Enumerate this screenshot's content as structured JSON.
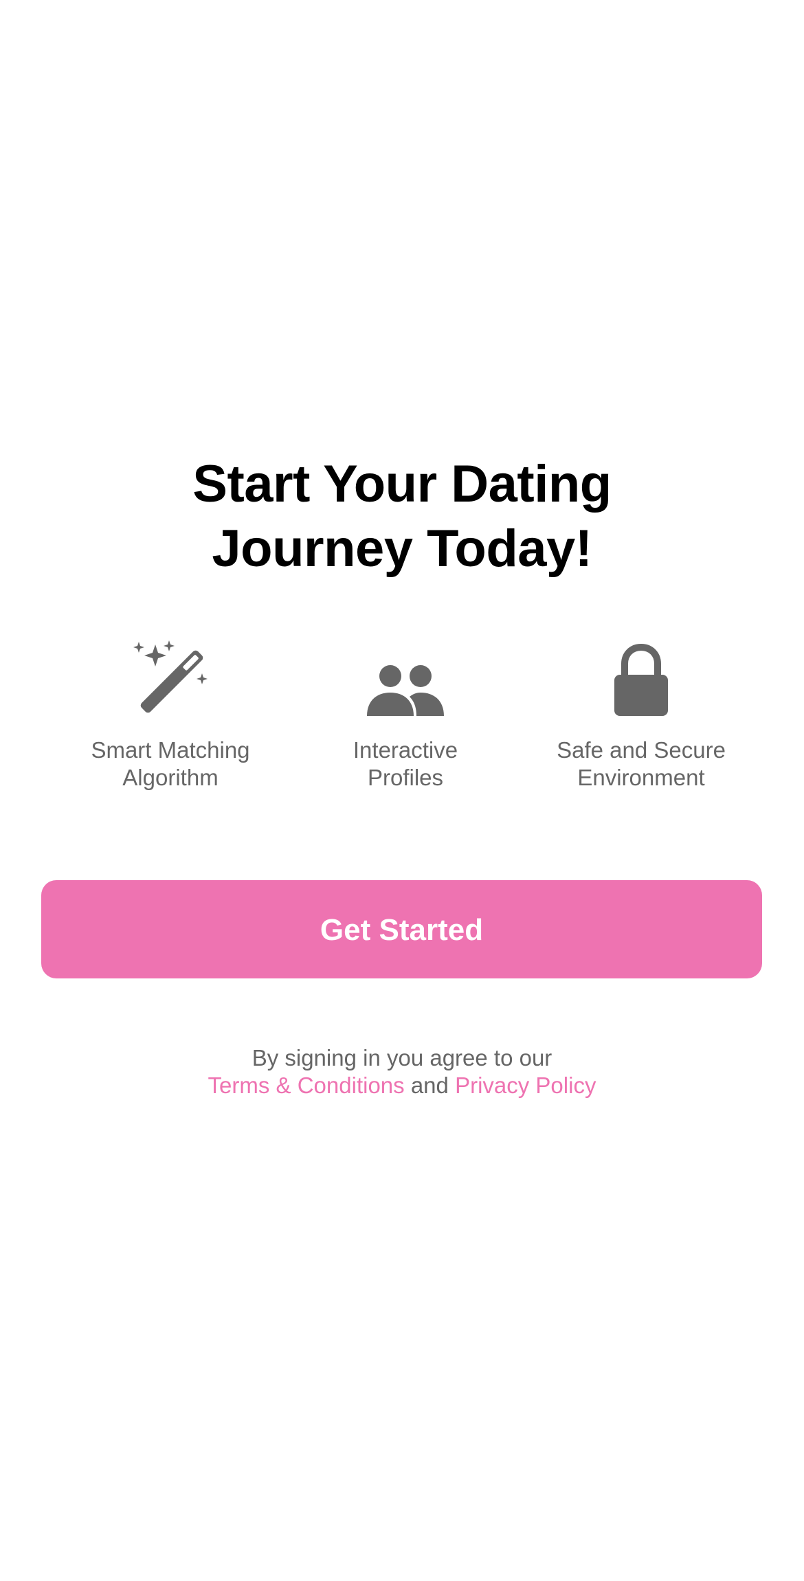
{
  "headline": {
    "line1": "Start Your Dating",
    "line2": "Journey Today!"
  },
  "features": [
    {
      "icon": "magic-wand-icon",
      "line1": "Smart Matching",
      "line2": "Algorithm"
    },
    {
      "icon": "people-icon",
      "line1": "Interactive",
      "line2": "Profiles"
    },
    {
      "icon": "lock-icon",
      "line1": "Safe and Secure",
      "line2": "Environment"
    }
  ],
  "cta": {
    "label": "Get Started"
  },
  "legal": {
    "intro": "By signing in you agree to our",
    "terms_link": "Terms & Conditions",
    "conjunction": "and",
    "privacy_link": "Privacy Policy"
  },
  "colors": {
    "accent": "#ee73b1",
    "text_primary": "#000000",
    "text_secondary": "#666666",
    "icon": "#666666",
    "background": "#ffffff"
  }
}
